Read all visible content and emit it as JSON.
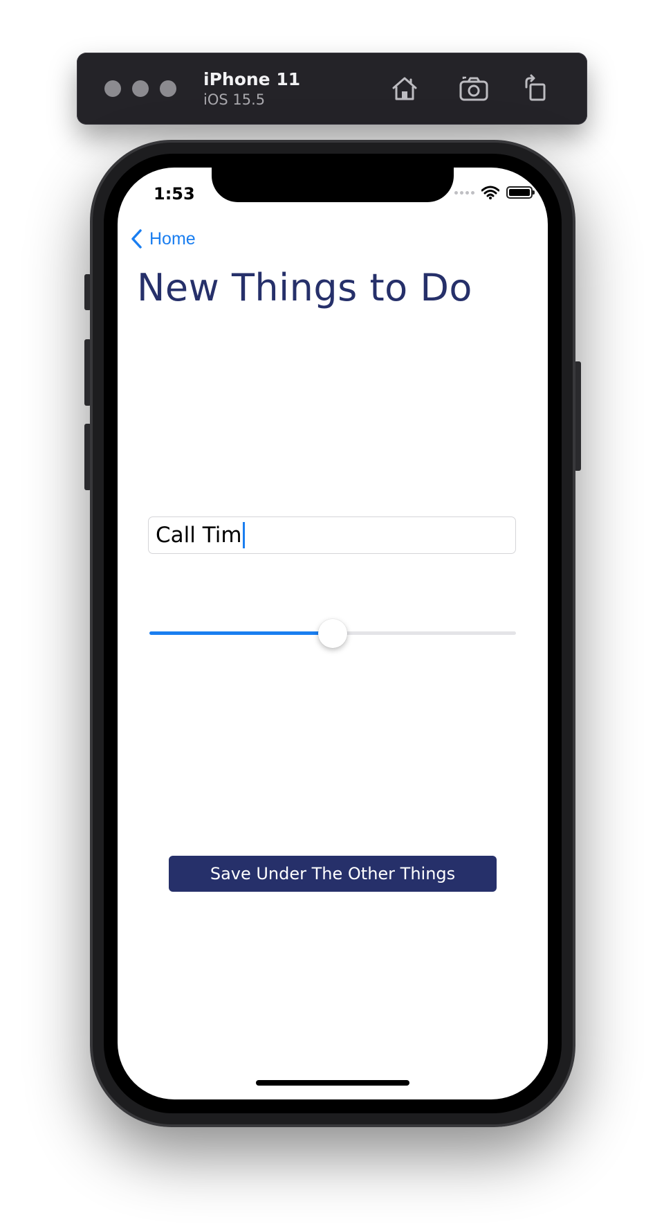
{
  "simulator": {
    "device_name": "iPhone 11",
    "os_version": "iOS 15.5",
    "icons": [
      "home-icon",
      "screenshot-icon",
      "rotate-icon"
    ]
  },
  "status_bar": {
    "time": "1:53",
    "icons": [
      "cellular-icon",
      "wifi-icon",
      "battery-icon"
    ]
  },
  "nav": {
    "back_label": "Home",
    "back_icon": "chevron-left-icon"
  },
  "page": {
    "title": "New Things to Do"
  },
  "form": {
    "task_value": "Call Tim",
    "slider_value": 0.5,
    "save_label": "Save Under The Other Things"
  },
  "colors": {
    "accent": "#1a7ef0",
    "title": "#26306a",
    "button_bg": "#26306a"
  }
}
